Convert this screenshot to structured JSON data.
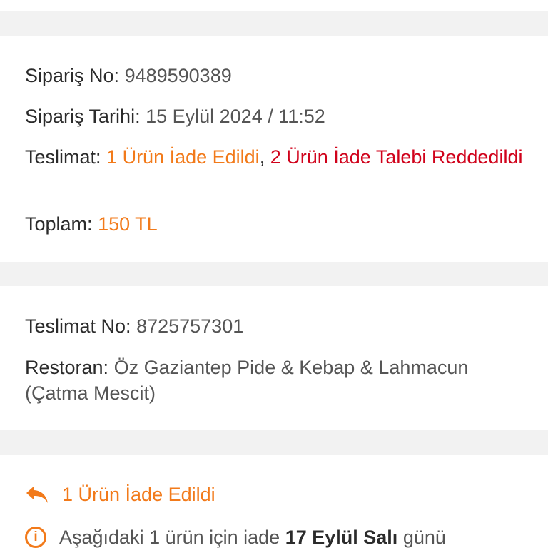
{
  "order": {
    "order_no_label": "Sipariş No:",
    "order_no": "9489590389",
    "order_date_label": "Sipariş Tarihi:",
    "order_date": "15 Eylül 2024 / 11:52",
    "delivery_label": "Teslimat:",
    "delivery_returned": "1 Ürün İade Edildi",
    "delivery_separator": ",",
    "delivery_rejected": "2 Ürün İade Talebi Reddedildi",
    "total_label": "Toplam:",
    "total": "150 TL"
  },
  "delivery": {
    "delivery_no_label": "Teslimat No:",
    "delivery_no": "8725757301",
    "restaurant_label": "Restoran:",
    "restaurant": "Öz Gaziantep Pide & Kebap & Lahmacun (Çatma Mescit)"
  },
  "return_status": {
    "icon": "reply-arrow-icon",
    "title": "1 Ürün İade Edildi",
    "info_icon": "info-icon",
    "info_prefix": "Aşağıdaki 1 ürün için iade",
    "info_date": "17 Eylül Salı",
    "info_suffix": "günü"
  },
  "colors": {
    "accent_orange": "#f27a1a",
    "reject_red": "#d0021b",
    "gap_gray": "#f2f2f2"
  }
}
